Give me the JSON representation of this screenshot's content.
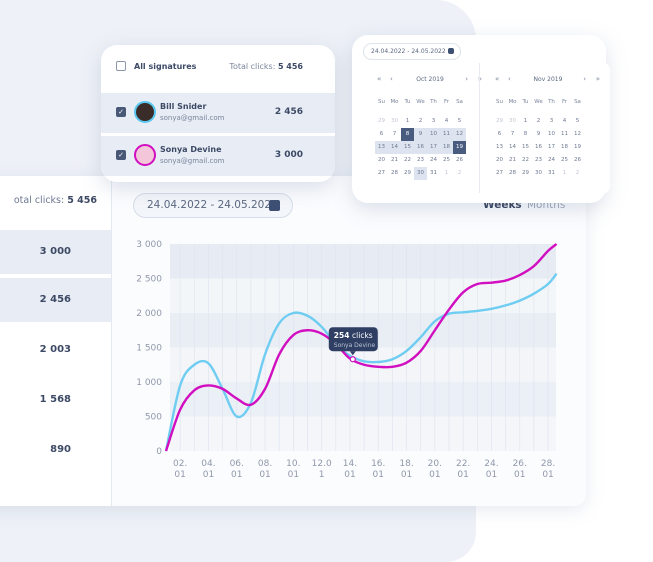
{
  "left_list": {
    "total_label": "otal clicks:",
    "total_value": "5 456",
    "rows": [
      "3 000",
      "2 456",
      "2 003",
      "1 568",
      "890"
    ]
  },
  "date_range": "24.04.2022 - 24.05.2022",
  "toggle": {
    "weeks": "Weeks",
    "months": "Months",
    "active": "weeks"
  },
  "signatures": {
    "all_label": "All signatures",
    "total_label": "Total clicks:",
    "total_value": "5 456",
    "people": [
      {
        "name": "Bill Snider",
        "email": "sonya@gmail.com",
        "clicks": "2 456",
        "checked": true,
        "ring": "#5bc8f0"
      },
      {
        "name": "Sonya Devine",
        "email": "sonya@gmail.com",
        "clicks": "3 000",
        "checked": true,
        "ring": "#d10fc0"
      }
    ]
  },
  "calendar": {
    "date_range": "24.04.2022 - 24.05.2022",
    "weekdays": [
      "Su",
      "Mo",
      "Tu",
      "We",
      "Th",
      "Fr",
      "Sa"
    ],
    "months": [
      {
        "title": "Oct 2019",
        "days": [
          "29",
          "30",
          "1",
          "2",
          "3",
          "4",
          "5",
          "6",
          "7",
          "8",
          "9",
          "10",
          "11",
          "12",
          "13",
          "14",
          "15",
          "16",
          "17",
          "18",
          "19",
          "20",
          "21",
          "22",
          "23",
          "24",
          "25",
          "26",
          "27",
          "28",
          "29",
          "30",
          "31",
          "1",
          "2"
        ],
        "range_start": "8",
        "range_end": "19",
        "hover": "30"
      },
      {
        "title": "Nov 2019",
        "days": [
          "29",
          "30",
          "1",
          "2",
          "3",
          "4",
          "5",
          "6",
          "7",
          "8",
          "9",
          "10",
          "11",
          "12",
          "13",
          "14",
          "15",
          "16",
          "17",
          "18",
          "19",
          "20",
          "21",
          "22",
          "23",
          "24",
          "25",
          "26",
          "27",
          "28",
          "29",
          "30",
          "31",
          "1",
          "2"
        ]
      }
    ],
    "nav": {
      "prev_year": "«",
      "prev": "‹",
      "next": "›",
      "next_year": "»"
    }
  },
  "chart_data": {
    "type": "line",
    "ylim": [
      0,
      3000
    ],
    "yticks": [
      "0",
      "500",
      "1 000",
      "1 500",
      "2 000",
      "2 500",
      "3 000"
    ],
    "ytick_values": [
      0,
      500,
      1000,
      1500,
      2000,
      2500,
      3000
    ],
    "xticks": [
      [
        "02.",
        "01"
      ],
      [
        "04.",
        "01"
      ],
      [
        "06.",
        "01"
      ],
      [
        "08.",
        "01"
      ],
      [
        "10.",
        "01"
      ],
      [
        "12.0",
        "1"
      ],
      [
        "14.",
        "01"
      ],
      [
        "16.",
        "01"
      ],
      [
        "18.",
        "01"
      ],
      [
        "20.",
        "01"
      ],
      [
        "22.",
        "01"
      ],
      [
        "24.",
        "01"
      ],
      [
        "26.",
        "01"
      ],
      [
        "28.",
        "01"
      ]
    ],
    "xtick_values": [
      2,
      4,
      6,
      8,
      10,
      12,
      14,
      16,
      18,
      20,
      22,
      24,
      26,
      28
    ],
    "grid": true,
    "series": [
      {
        "color": "#6fcdf2",
        "points": [
          [
            1,
            0
          ],
          [
            2,
            950
          ],
          [
            3,
            1250
          ],
          [
            4,
            1270
          ],
          [
            5,
            900
          ],
          [
            6,
            500
          ],
          [
            7,
            700
          ],
          [
            8,
            1400
          ],
          [
            9,
            1850
          ],
          [
            10,
            2000
          ],
          [
            11,
            1960
          ],
          [
            12,
            1800
          ],
          [
            13,
            1550
          ],
          [
            14,
            1380
          ],
          [
            15,
            1300
          ],
          [
            16,
            1290
          ],
          [
            17,
            1330
          ],
          [
            18,
            1450
          ],
          [
            19,
            1650
          ],
          [
            20,
            1880
          ],
          [
            21,
            1990
          ],
          [
            22,
            2010
          ],
          [
            23,
            2030
          ],
          [
            24,
            2060
          ],
          [
            25,
            2110
          ],
          [
            26,
            2180
          ],
          [
            27,
            2280
          ],
          [
            28,
            2420
          ],
          [
            28.6,
            2570
          ]
        ]
      },
      {
        "name": "Sonya Devine",
        "color": "#d10fc0",
        "points": [
          [
            1,
            0
          ],
          [
            2,
            600
          ],
          [
            3,
            880
          ],
          [
            4,
            950
          ],
          [
            5,
            900
          ],
          [
            6,
            760
          ],
          [
            7,
            670
          ],
          [
            8,
            900
          ],
          [
            9,
            1400
          ],
          [
            10,
            1680
          ],
          [
            11,
            1750
          ],
          [
            12,
            1700
          ],
          [
            13,
            1550
          ],
          [
            14,
            1340
          ],
          [
            15,
            1250
          ],
          [
            16,
            1220
          ],
          [
            17,
            1220
          ],
          [
            18,
            1280
          ],
          [
            19,
            1450
          ],
          [
            20,
            1750
          ],
          [
            21,
            2050
          ],
          [
            22,
            2300
          ],
          [
            23,
            2420
          ],
          [
            24,
            2440
          ],
          [
            25,
            2470
          ],
          [
            26,
            2550
          ],
          [
            27,
            2680
          ],
          [
            28,
            2900
          ],
          [
            28.6,
            3000
          ]
        ]
      }
    ],
    "tooltip": {
      "x": 14.2,
      "y": 1330,
      "value": "254",
      "unit": "clicks",
      "name": "Sonya Devine"
    }
  }
}
